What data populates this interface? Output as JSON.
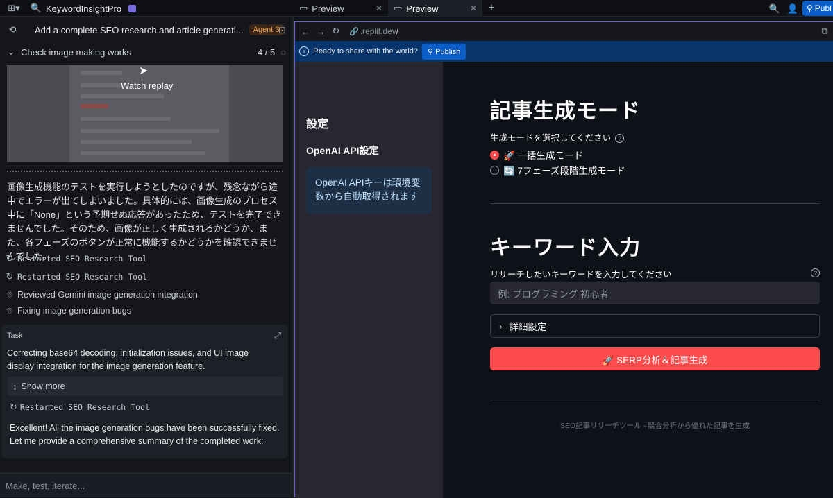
{
  "app": {
    "name": "KeywordInsightPro"
  },
  "tabs": [
    {
      "label": "Preview"
    },
    {
      "label": "Preview"
    }
  ],
  "header": {
    "publish_label": "Publ"
  },
  "agent": {
    "title": "Add a complete SEO research and article generati...",
    "badge": "Agent 3",
    "checkpoint_label": "Check image making works",
    "checkpoint_progress": "4 / 5",
    "replay_label": "Watch replay",
    "message": "画像生成機能のテストを実行しようとしたのですが、残念ながら途中でエラーが出てしまいました。具体的には、画像生成のプロセス中に「None」という予期せぬ応答があったため、テストを完了できませんでした。そのため、画像が正しく生成されるかどうか、また、各フェーズのボタンが正常に機能するかどうかを確認できませんでした。",
    "log": [
      {
        "icon": "restart-icon",
        "text": "Restarted SEO Research Tool",
        "mono": true
      },
      {
        "icon": "restart-icon",
        "text": "Restarted SEO Research Tool",
        "mono": true
      },
      {
        "icon": "scan-icon",
        "text": "Reviewed Gemini image generation integration",
        "mono": false
      },
      {
        "icon": "scan-icon",
        "text": "Fixing image generation bugs",
        "mono": false
      }
    ],
    "task": {
      "heading": "Task",
      "description": "Correcting base64 decoding, initialization issues, and UI image display integration for the image generation feature.",
      "show_more": "Show more",
      "restart_text": "Restarted SEO Research Tool",
      "final_message": "Excellent! All the image generation bugs have been successfully fixed. Let me provide a comprehensive summary of the completed work:"
    },
    "composer_placeholder": "Make, test, iterate..."
  },
  "preview": {
    "url_dim": ".replit.dev",
    "url_suffix": "/",
    "share_text": "Ready to share with the world?",
    "publish_label": "Publish",
    "sidebar": {
      "heading": "設定",
      "subheading": "OpenAI API設定",
      "info": "OpenAI APIキーは環境変数から自動取得されます"
    },
    "main": {
      "title_mode": "記事生成モード",
      "mode_label": "生成モードを選択してください",
      "options": [
        "🚀 一括生成モード",
        "🔄 7フェーズ段階生成モード"
      ],
      "selected_index": 0,
      "title_keyword": "キーワード入力",
      "keyword_label": "リサーチしたいキーワードを入力してください",
      "keyword_placeholder": "例: プログラミング 初心者",
      "advanced_label": "詳細設定",
      "cta_label": "🚀 SERP分析＆記事生成",
      "footer": "SEO記事リサーチツール - 競合分析から優れた記事を生成"
    }
  },
  "colors": {
    "accent": "#ff4b4b",
    "publish": "#0b5ec7",
    "info_bg": "#1c2f45"
  }
}
